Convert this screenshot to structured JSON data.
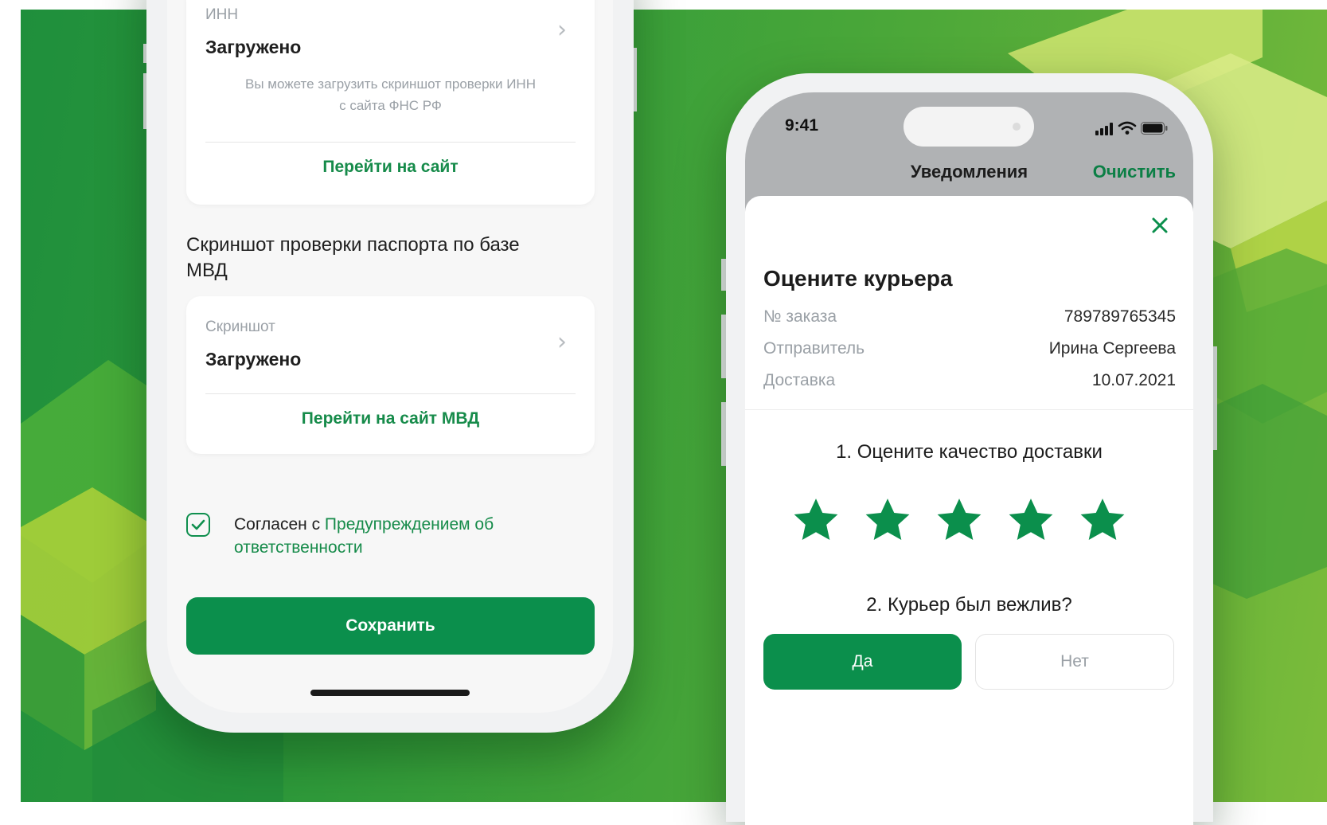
{
  "left_phone": {
    "inn_card": {
      "label": "ИНН",
      "status": "Загружено",
      "hint_line1": "Вы можете загрузить скриншот проверки ИНН",
      "hint_line2": "с сайта ФНС РФ",
      "link": "Перейти на сайт"
    },
    "passport_section": {
      "title_line1": "Скриншот проверки паспорта по базе",
      "title_line2": "МВД"
    },
    "screenshot_card": {
      "label": "Скриншот",
      "status": "Загружено",
      "link": "Перейти на сайт МВД"
    },
    "agreement": {
      "prefix": "Согласен с ",
      "link_part1": "Предупреждением об",
      "link_part2": "ответственности",
      "checked": true
    },
    "save_label": "Сохранить"
  },
  "right_phone": {
    "status_bar": {
      "time": "9:41"
    },
    "nav": {
      "title": "Уведомления",
      "action": "Очистить"
    },
    "sheet": {
      "title": "Оцените курьера",
      "rows": [
        {
          "label": "№ заказа",
          "value": "789789765345"
        },
        {
          "label": "Отправитель",
          "value": "Ирина Сергеева"
        },
        {
          "label": "Доставка",
          "value": "10.07.2021"
        }
      ],
      "question1": "1. Оцените качество доставки",
      "rating": 5,
      "rating_max": 5,
      "question2": "2. Курьер был вежлив?",
      "yes_label": "Да",
      "no_label": "Нет"
    }
  },
  "colors": {
    "brand_green": "#0b8f4c",
    "link_green": "#168b4a",
    "background_green": "#3a9c3a"
  },
  "icons": [
    "chevron-right-icon",
    "checkbox-checked-icon",
    "close-icon",
    "star-icon",
    "signal-icon",
    "wifi-icon",
    "battery-icon"
  ]
}
